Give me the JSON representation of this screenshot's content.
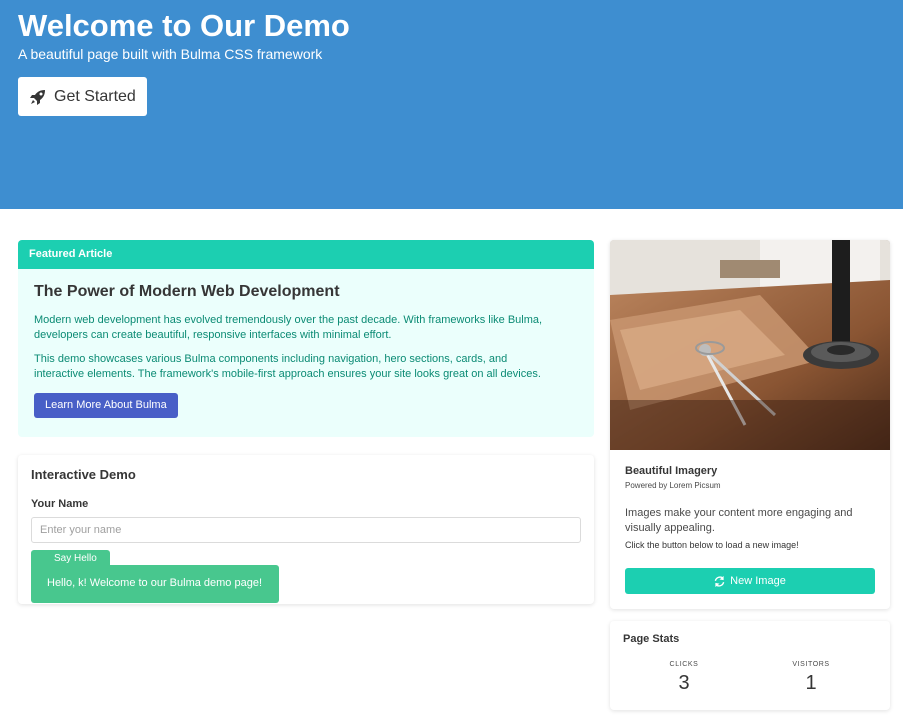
{
  "hero": {
    "title": "Welcome to Our Demo",
    "subtitle": "A beautiful page built with Bulma CSS framework",
    "button_label": "Get Started",
    "button_icon": "rocket-icon",
    "background_color": "#3e8ed0"
  },
  "article": {
    "header": "Featured Article",
    "title": "The Power of Modern Web Development",
    "paragraphs": [
      "Modern web development has evolved tremendously over the past decade. With frameworks like Bulma, developers can create beautiful, responsive interfaces with minimal effort.",
      "This demo showcases various Bulma components including navigation, hero sections, cards, and interactive elements. The framework's mobile-first approach ensures your site looks great on all devices."
    ],
    "button_label": "Learn More About Bulma",
    "accent_color": "#1ccfb1"
  },
  "demo": {
    "title": "Interactive Demo",
    "name_label": "Your Name",
    "name_placeholder": "Enter your name",
    "name_value": "",
    "button_label": "Say Hello",
    "notification": "Hello, k! Welcome to our Bulma demo page!",
    "success_color": "#48c78e"
  },
  "image_card": {
    "title": "Beautiful Imagery",
    "subtitle": "Powered by Lorem Picsum",
    "description": "Images make your content more engaging and visually appealing.",
    "hint": "Click the button below to load a new image!",
    "button_label": "New Image",
    "button_icon": "refresh-icon"
  },
  "stats": {
    "title": "Page Stats",
    "items": [
      {
        "label": "CLICKS",
        "value": "3"
      },
      {
        "label": "VISITORS",
        "value": "1"
      }
    ]
  }
}
